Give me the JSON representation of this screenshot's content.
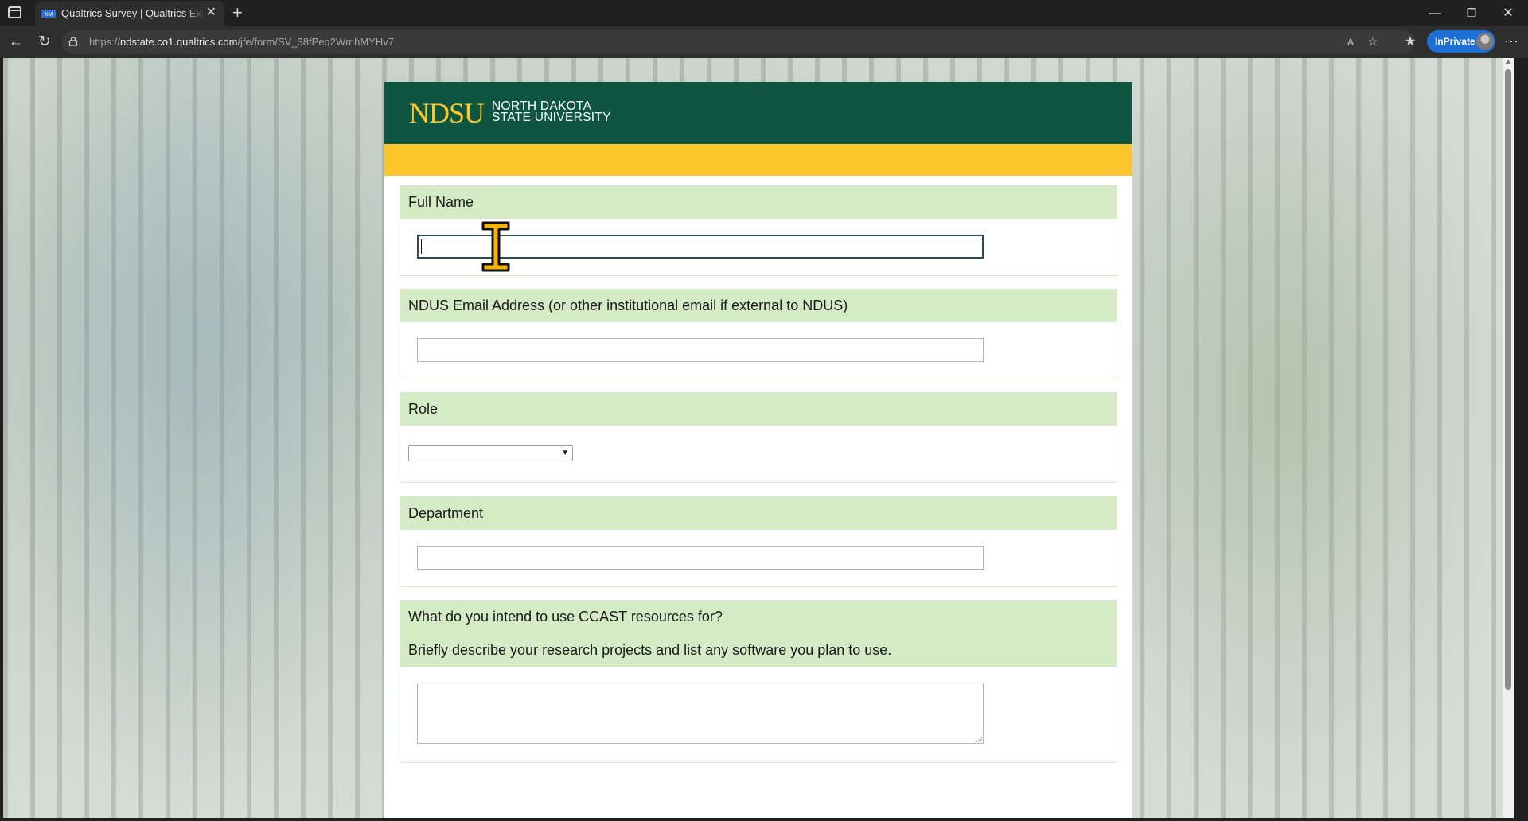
{
  "browser": {
    "tab_title": "Qualtrics Survey | Qualtrics Experience Management",
    "tab_close": "✕",
    "new_tab": "+",
    "url_prefix": "https://",
    "url_domain": "ndstate.co1.qualtrics.com",
    "url_path": "/jfe/form/SV_38fPeq2WmhMYHv7",
    "inprivate_label": "InPrivate",
    "window_controls": {
      "minimize": "—",
      "restore": "❐",
      "close": "✕"
    },
    "icons": [
      "tab-actions-icon",
      "back-icon",
      "refresh-icon",
      "lock-icon",
      "read-aloud-icon",
      "favorite-star-icon",
      "favorites-icon",
      "more-icon"
    ]
  },
  "header": {
    "logo_mark": "NDSU",
    "logo_line1": "NORTH DAKOTA",
    "logo_line2": "STATE UNIVERSITY",
    "colors": {
      "green": "#0f5640",
      "gold": "#fcc52d",
      "question_bg": "#d4ebc6"
    }
  },
  "form": {
    "full_name": {
      "label": "Full Name",
      "value": ""
    },
    "email": {
      "label": "NDUS Email Address (or other institutional email if external to NDUS)",
      "value": ""
    },
    "role": {
      "label": "Role",
      "selected": ""
    },
    "department": {
      "label": "Department",
      "value": ""
    },
    "ccast": {
      "label": "What do you intend to use CCAST resources for?",
      "sublabel": "Briefly describe your research projects and list any software you plan to use.",
      "value": ""
    }
  }
}
